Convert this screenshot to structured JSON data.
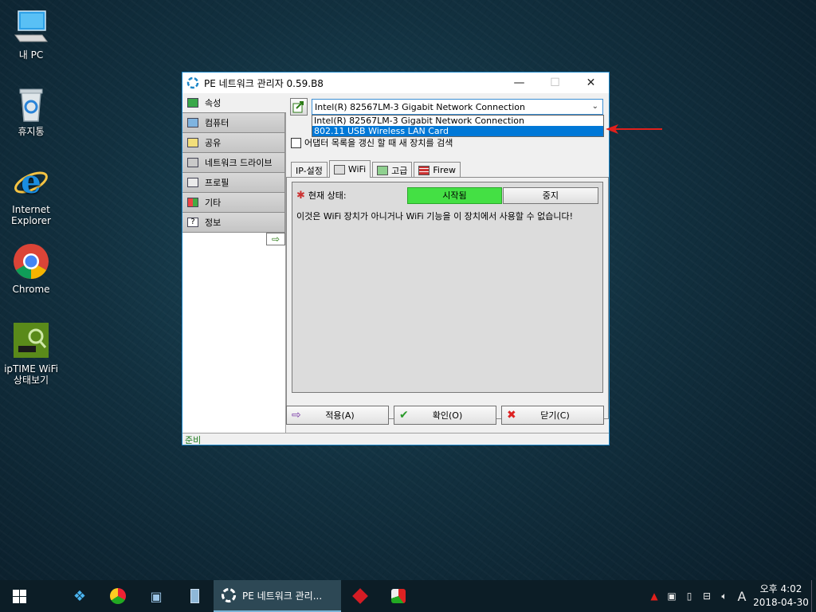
{
  "desktop": {
    "icons": [
      {
        "label": "내 PC",
        "icon": "computer-icon"
      },
      {
        "label": "휴지통",
        "icon": "recycle-bin-icon"
      },
      {
        "label": "Internet\nExplorer",
        "icon": "internet-explorer-icon"
      },
      {
        "label": "Chrome",
        "icon": "chrome-icon"
      },
      {
        "label": "ipTIME WiFi\n상태보기",
        "icon": "iptime-wifi-icon"
      }
    ]
  },
  "window": {
    "title": "PE 네트워크 관리자 0.59.B8",
    "controls": {
      "minimize": "—",
      "maximize": "☐",
      "close": "✕"
    },
    "nav": [
      {
        "label": "속성",
        "active": true
      },
      {
        "label": "컴퓨터"
      },
      {
        "label": "공유"
      },
      {
        "label": "네트워크 드라이브"
      },
      {
        "label": "프로필"
      },
      {
        "label": "기타"
      },
      {
        "label": "정보"
      }
    ],
    "adapter": {
      "selected": "Intel(R) 82567LM-3 Gigabit Network Connection",
      "options": [
        "Intel(R) 82567LM-3 Gigabit Network Connection",
        "802.11 USB Wireless LAN Card"
      ],
      "highlighted_option": "802.11 USB Wireless LAN Card"
    },
    "refresh_checkbox_label": "어댑터 목록을 갱신 할 때 새 장치를 검색",
    "tabs": [
      "IP-설정",
      "WiFi",
      "고급",
      "Firew"
    ],
    "wifi": {
      "status_label": "현재 상태:",
      "status_value": "시작됨",
      "stop_label": "중지",
      "message": "이것은 WiFi 장치가 아니거나 WiFi 기능을 이 장치에서 사용할 수 없습니다!"
    },
    "buttons": {
      "apply": "적용(A)",
      "ok": "확인(O)",
      "close": "닫기(C)"
    },
    "status": "준비"
  },
  "taskbar": {
    "active_app": "PE 네트워크 관리...",
    "clock_time": "오후 4:02",
    "clock_date": "2018-04-30",
    "ime": "A"
  },
  "colors": {
    "status_started": "#44e044",
    "accent": "#0078d7",
    "annotation_arrow": "#e0201c"
  }
}
